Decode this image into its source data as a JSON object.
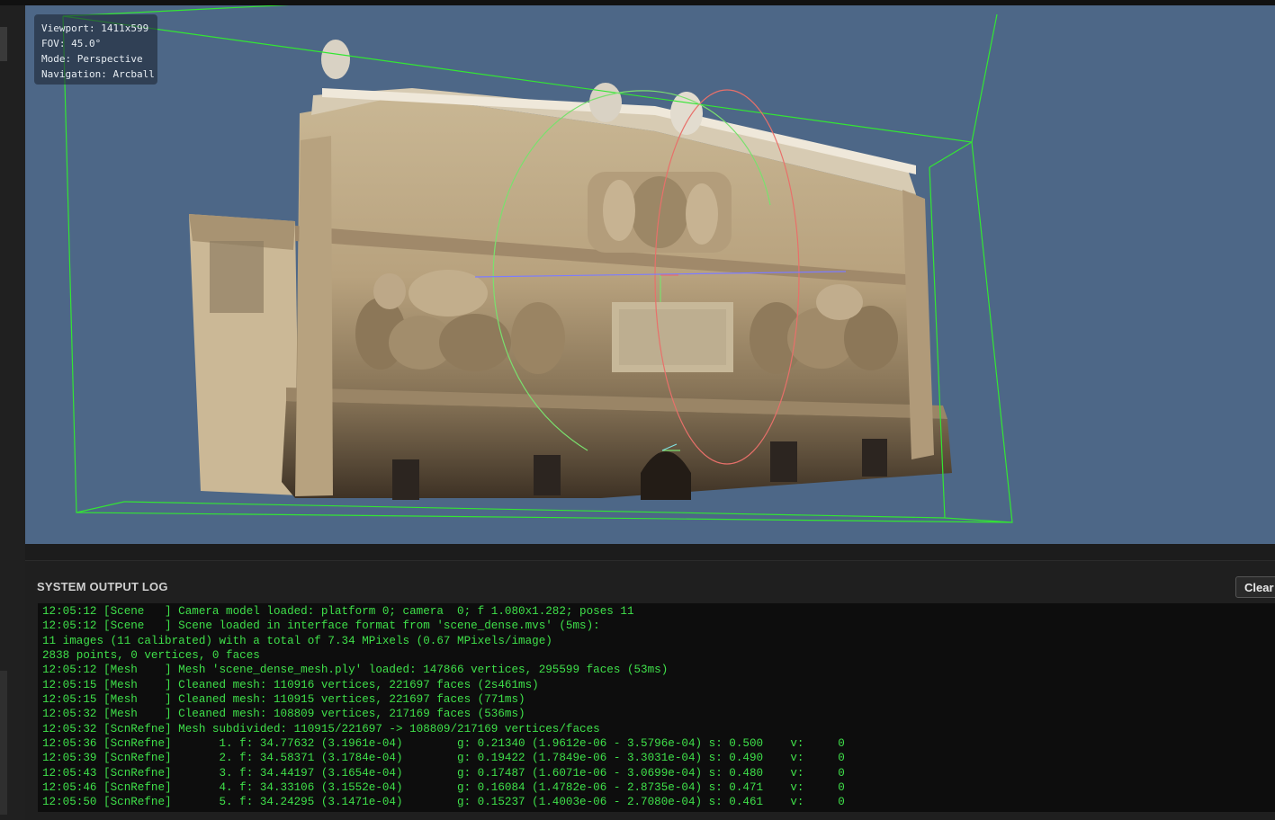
{
  "viewport": {
    "info_lines": [
      "Viewport: 1411x599",
      "FOV: 45.0°",
      "Mode: Perspective",
      "Navigation: Arcball"
    ],
    "background_color": "#4d6787",
    "bbox_color": "#33e633",
    "gizmo_colors": {
      "x": "#e8706a",
      "y": "#7ae06e",
      "z": "#7c7cff"
    }
  },
  "log": {
    "title": "SYSTEM OUTPUT LOG",
    "clear_label": "Clear",
    "text_color": "#3fe04a",
    "lines": [
      "12:05:12 [Scene   ] Camera model loaded: platform 0; camera  0; f 1.080x1.282; poses 11",
      "12:05:12 [Scene   ] Scene loaded in interface format from 'scene_dense.mvs' (5ms):",
      "11 images (11 calibrated) with a total of 7.34 MPixels (0.67 MPixels/image)",
      "2838 points, 0 vertices, 0 faces",
      "12:05:12 [Mesh    ] Mesh 'scene_dense_mesh.ply' loaded: 147866 vertices, 295599 faces (53ms)",
      "12:05:15 [Mesh    ] Cleaned mesh: 110916 vertices, 221697 faces (2s461ms)",
      "12:05:15 [Mesh    ] Cleaned mesh: 110915 vertices, 221697 faces (771ms)",
      "12:05:32 [Mesh    ] Cleaned mesh: 108809 vertices, 217169 faces (536ms)",
      "12:05:32 [ScnRefne] Mesh subdivided: 110915/221697 -> 108809/217169 vertices/faces",
      "12:05:36 [ScnRefne]       1. f: 34.77632 (3.1961e-04)        g: 0.21340 (1.9612e-06 - 3.5796e-04) s: 0.500    v:     0",
      "12:05:39 [ScnRefne]       2. f: 34.58371 (3.1784e-04)        g: 0.19422 (1.7849e-06 - 3.3031e-04) s: 0.490    v:     0",
      "12:05:43 [ScnRefne]       3. f: 34.44197 (3.1654e-04)        g: 0.17487 (1.6071e-06 - 3.0699e-04) s: 0.480    v:     0",
      "12:05:46 [ScnRefne]       4. f: 34.33106 (3.1552e-04)        g: 0.16084 (1.4782e-06 - 2.8735e-04) s: 0.471    v:     0",
      "12:05:50 [ScnRefne]       5. f: 34.24295 (3.1471e-04)        g: 0.15237 (1.4003e-06 - 2.7080e-04) s: 0.461    v:     0"
    ]
  }
}
